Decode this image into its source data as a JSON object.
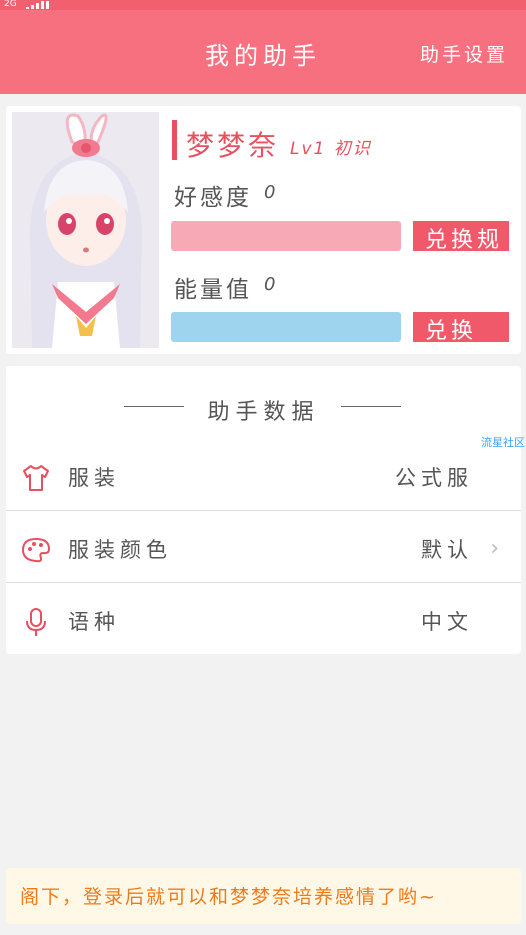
{
  "status_bar": {
    "network": "2G"
  },
  "header": {
    "title": "我的助手",
    "settings_label": "助手设置"
  },
  "profile": {
    "name": "梦梦奈",
    "level": "Lv1 初识",
    "favor_label": "好感度",
    "favor_value": "0",
    "favor_button": "兑换规",
    "energy_label": "能量值",
    "energy_value": "0",
    "energy_button": "兑换"
  },
  "assistant_data": {
    "section_title": "助手数据",
    "rows": [
      {
        "label": "服装",
        "value": "公式服",
        "tag": "流星社区",
        "icon": "shirt-icon"
      },
      {
        "label": "服装颜色",
        "value": "默认",
        "icon": "palette-icon",
        "chevron": "›"
      },
      {
        "label": "语种",
        "value": "中文",
        "icon": "microphone-icon"
      }
    ]
  },
  "hint": "阁下，登录后就可以和梦梦奈培养感情了哟~",
  "colors": {
    "header": "#f6707f",
    "accent": "#e8505f",
    "favor_bar": "#f7aab5",
    "energy_bar": "#9fd4ef",
    "hint_text": "#f07a1a"
  }
}
